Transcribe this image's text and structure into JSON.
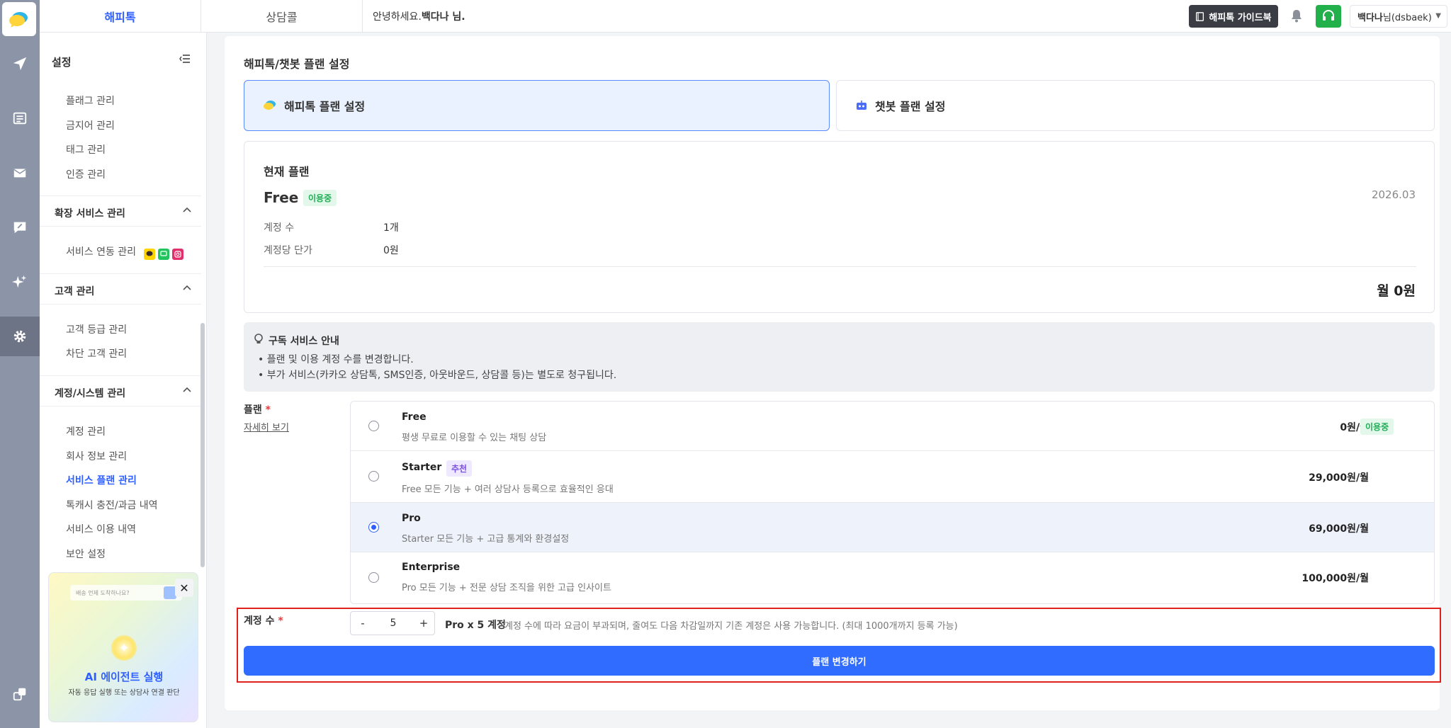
{
  "topbar": {
    "tabs": [
      "해피톡",
      "상담콜"
    ],
    "greeting_prefix": "안녕하세요.",
    "greeting_name": "백다나 님.",
    "guide_button": "해피톡 가이드북",
    "user_name": "백다나",
    "user_suffix": "님(dsbaek)"
  },
  "rail": {
    "icons": [
      "happytalk-logo-icon",
      "send-icon",
      "list-icon",
      "mail-icon",
      "chat-edit-icon",
      "sparkle-icon",
      "gear-icon",
      "link-icon"
    ]
  },
  "sidebar": {
    "title": "설정",
    "items_top": [
      "플래그 관리",
      "금지어 관리",
      "태그 관리",
      "인증 관리"
    ],
    "section_ext": "확장 서비스 관리",
    "ext_items": [
      "서비스 연동 관리"
    ],
    "section_customer": "고객 관리",
    "customer_items": [
      "고객 등급 관리",
      "차단 고객 관리"
    ],
    "section_account": "계정/시스템 관리",
    "account_items": [
      "계정 관리",
      "회사 정보 관리",
      "서비스 플랜 관리",
      "톡캐시 충전/과금 내역",
      "서비스 이용 내역",
      "보안 설정"
    ],
    "active_item": "서비스 플랜 관리"
  },
  "promo": {
    "question": "배송 언제 도착하나요?",
    "title": "AI 에이전트 실행",
    "subtitle": "자동 응답 실행 또는 상담사 연결 판단"
  },
  "main": {
    "title": "해피톡/챗봇 플랜 설정",
    "tabs": [
      "해피톡 플랜 설정",
      "챗봇 플랜 설정"
    ],
    "current": {
      "label": "현재 플랜",
      "plan": "Free",
      "badge": "이용중",
      "date": "2026.03",
      "rows": [
        {
          "key": "계정 수",
          "value": "1개"
        },
        {
          "key": "계정당 단가",
          "value": "0원"
        }
      ],
      "total": "월 0원"
    },
    "notice": {
      "title": "구독 서비스 안내",
      "lines": [
        "• 플랜 및 이용 계정 수를 변경합니다.",
        "• 부가 서비스(카카오 상담톡, SMS인증, 아웃바운드, 상담콜 등)는 별도로 청구됩니다."
      ]
    },
    "plan_label": "플랜",
    "required_mark": "*",
    "detail_link": "자세히 보기",
    "plans": [
      {
        "name": "Free",
        "desc": "평생 무료로 이용할 수 있는 채팅 상담",
        "price": "0원/월",
        "badge": "이용중"
      },
      {
        "name": "Starter",
        "desc": "Free 모든 기능 + 여러 상담사 등록으로 효율적인 응대",
        "price": "29,000원/월",
        "tag": "추천"
      },
      {
        "name": "Pro",
        "desc": "Starter 모든 기능 + 고급 통계와 환경설정",
        "price": "69,000원/월"
      },
      {
        "name": "Enterprise",
        "desc": "Pro 모든 기능 + 전문 상담 조직을 위한 고급 인사이트",
        "price": "100,000원/월"
      }
    ],
    "selected_plan": "Pro",
    "account": {
      "label": "계정 수",
      "minus": "-",
      "value": "5",
      "plus": "+",
      "summary": "Pro x 5 계정",
      "note": "계정 수에 따라 요금이 부과되며, 줄여도 다음 차감일까지 기존 계정은 사용 가능합니다. (최대 1000개까지 등록 가능)"
    },
    "submit": "플랜 변경하기"
  },
  "colors": {
    "primary": "#2f6cff",
    "rail": "#8c95a7",
    "highlight": "#e0201b",
    "badge_green": "#1fae55",
    "badge_purple": "#7b4fe0"
  }
}
